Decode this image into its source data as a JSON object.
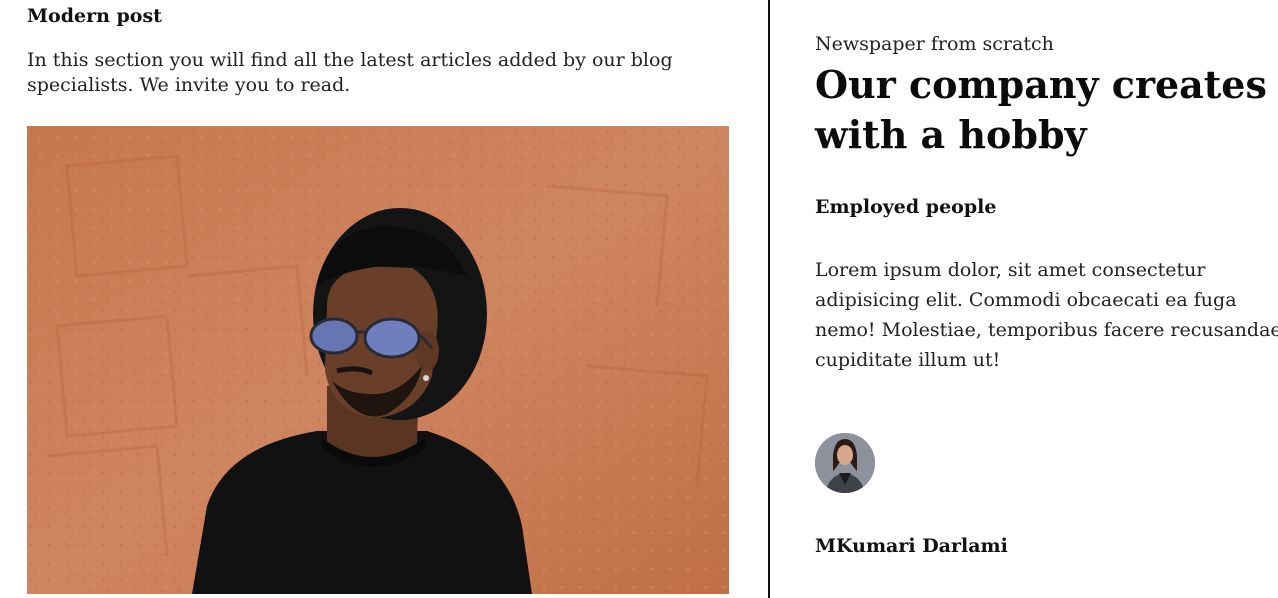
{
  "left": {
    "heading": "Modern post",
    "description": "In this section you will find all the latest articles added by our blog specialists. We invite you to read."
  },
  "right": {
    "kicker": "Newspaper from scratch",
    "headline": "Our company creates with a hobby",
    "subheading": "Employed people",
    "body": "Lorem ipsum dolor, sit amet consectetur adipisicing elit. Commodi obcaecati ea fuga nemo! Molestiae, temporibus facere recusandae cupiditate illum ut!",
    "author_name": "MKumari Darlami"
  },
  "colors": {
    "text": "#111111",
    "wall": "#c9794f",
    "divider": "#111111"
  }
}
